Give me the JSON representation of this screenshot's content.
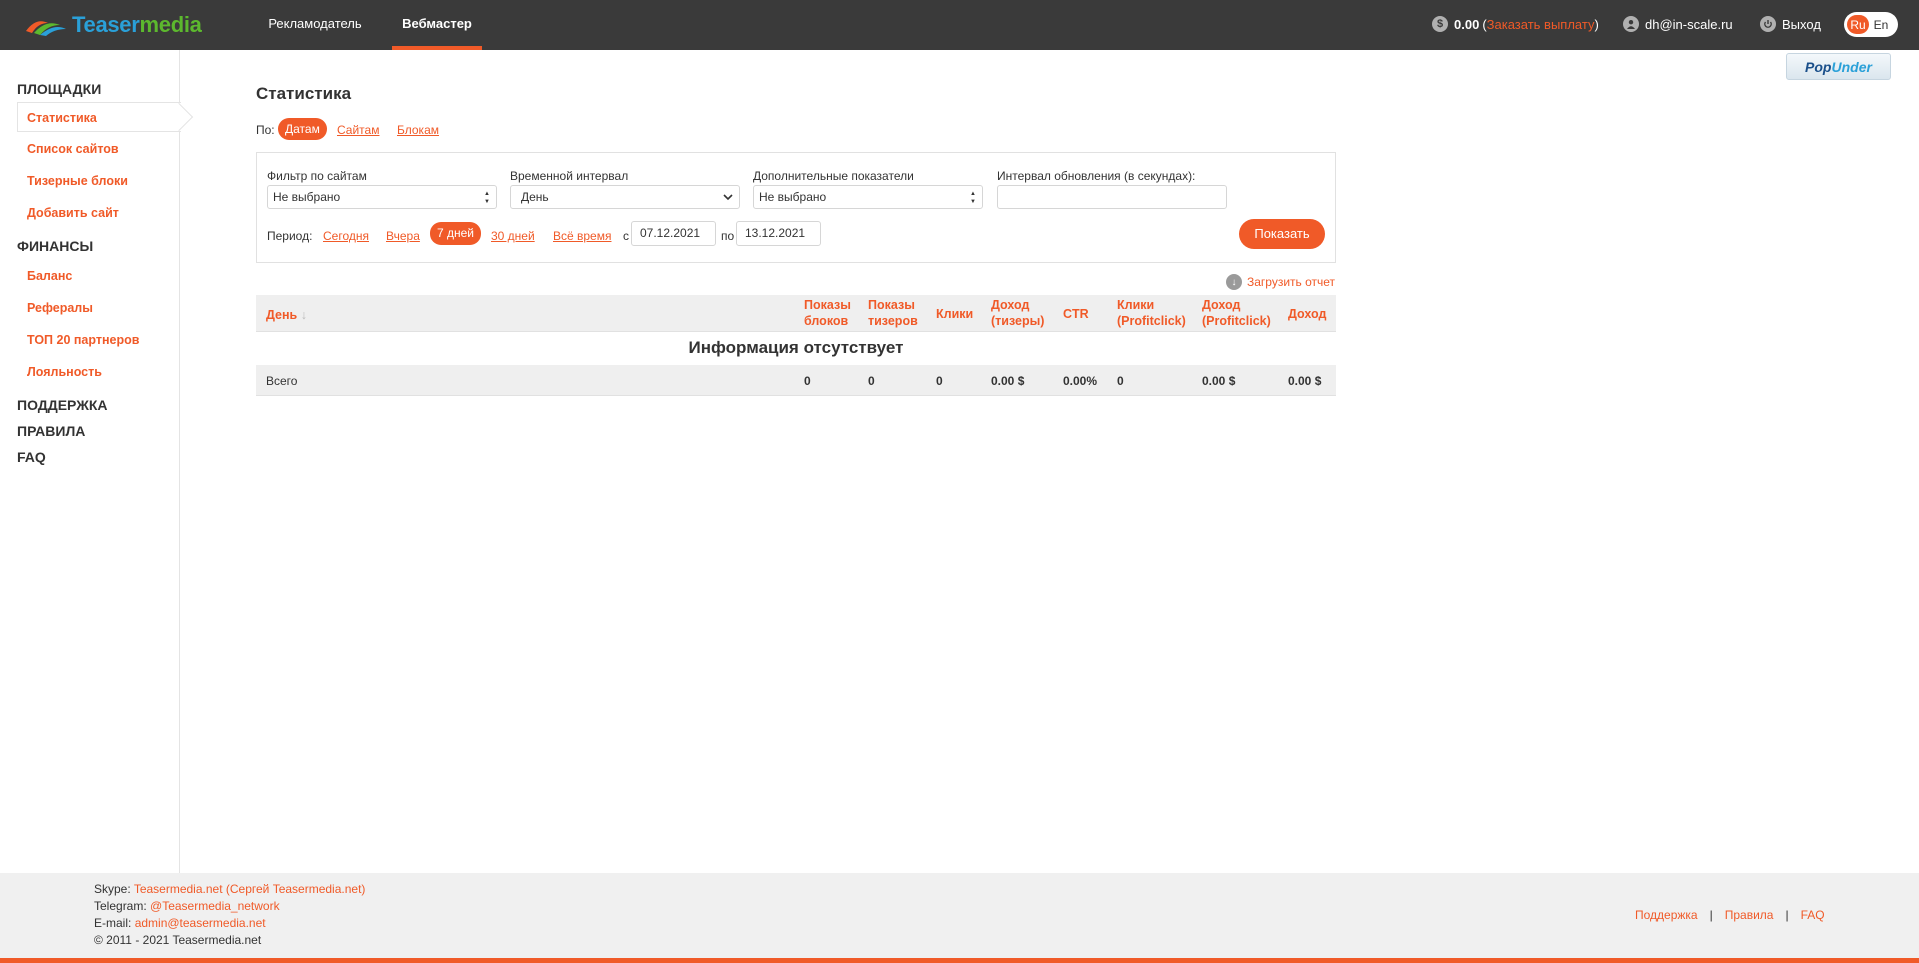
{
  "header": {
    "logo_part1": "Teaser",
    "logo_part2": "media",
    "nav": [
      "Рекламодатель",
      "Вебмастер"
    ],
    "balance": "0.00",
    "payout_link": "Заказать выплату",
    "user_email": "dh@in-scale.ru",
    "logout": "Выход",
    "lang_ru": "Ru",
    "lang_en": "En"
  },
  "sidebar": {
    "sections": [
      {
        "title": "ПЛОЩАДКИ",
        "items": [
          "Статистика",
          "Список сайтов",
          "Тизерные блоки",
          "Добавить сайт"
        ]
      },
      {
        "title": "ФИНАНСЫ",
        "items": [
          "Баланс",
          "Рефералы",
          "ТОП 20 партнеров",
          "Лояльность"
        ]
      },
      {
        "title": "ПОДДЕРЖКА",
        "items": []
      },
      {
        "title": "ПРАВИЛА",
        "items": []
      },
      {
        "title": "FAQ",
        "items": []
      }
    ]
  },
  "promo": {
    "part1": "Pop",
    "part2": "Under"
  },
  "main": {
    "title": "Статистика",
    "by_label": "По:",
    "by_tabs": [
      "Датам",
      "Сайтам",
      "Блокам"
    ],
    "filters": {
      "site_label": "Фильтр по сайтам",
      "site_value": "Не выбрано",
      "interval_label": "Временной интервал",
      "interval_value": "День",
      "extra_label": "Дополнительные показатели",
      "extra_value": "Не выбрано",
      "refresh_label": "Интервал обновления (в секундах):",
      "refresh_value": ""
    },
    "period": {
      "label": "Период:",
      "options": [
        "Сегодня",
        "Вчера",
        "7 дней",
        "30 дней",
        "Всё время"
      ],
      "active": "7 дней",
      "from_label": "с",
      "from": "07.12.2021",
      "to_label": "по",
      "to": "13.12.2021"
    },
    "show_button": "Показать",
    "download": "Загрузить отчет",
    "table": {
      "columns": [
        "День",
        "Показы блоков",
        "Показы тизеров",
        "Клики",
        "Доход (тизеры)",
        "CTR",
        "Клики (Profitclick)",
        "Доход (Profitclick)",
        "Доход"
      ],
      "empty_message": "Информация отсутствует",
      "total_label": "Всего",
      "totals": [
        "0",
        "0",
        "0",
        "0.00 $",
        "0.00%",
        "0",
        "0.00 $",
        "0.00 $"
      ]
    }
  },
  "footer": {
    "skype_label": "Skype:",
    "skype": "Teasermedia.net (Сергей Teasermedia.net)",
    "telegram_label": "Telegram:",
    "telegram": "@Teasermedia_network",
    "email_label": "E-mail:",
    "email": "admin@teasermedia.net",
    "copyright": "© 2011 - 2021 Teasermedia.net",
    "links": [
      "Поддержка",
      "Правила",
      "FAQ"
    ]
  },
  "colors": {
    "accent": "#f05a28",
    "topbar": "#3a3a3a",
    "footer_bg": "#f0f0f0"
  }
}
